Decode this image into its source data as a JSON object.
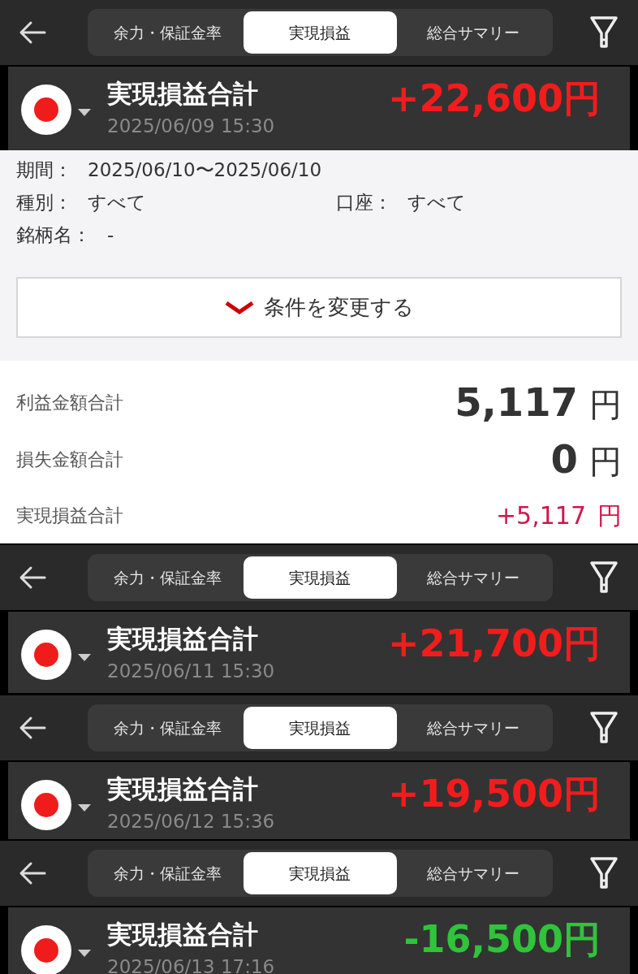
{
  "panels": [
    {
      "tabs": [
        {
          "label": "余力・保証金率",
          "selected": false
        },
        {
          "label": "実現損益",
          "selected": true
        },
        {
          "label": "総合サマリー",
          "selected": false
        }
      ],
      "summary": {
        "title": "実現損益合計",
        "amount": "+22,600円",
        "kind": "gain",
        "timestamp": "2025/06/09 15:30"
      },
      "conditions": {
        "period_label": "期間：",
        "period": "2025/06/10〜2025/06/10",
        "type_label": "種別：",
        "type": "すべて",
        "account_label": "口座：",
        "account": "すべて",
        "symbol_label": "銘柄名：",
        "symbol": "-",
        "change_button": "条件を変更する"
      },
      "totals": [
        {
          "label": "利益金額合計",
          "value": "5,117",
          "unit": "円",
          "kind": "large"
        },
        {
          "label": "損失金額合計",
          "value": "0",
          "unit": "円",
          "kind": "large"
        },
        {
          "label": "実現損益合計",
          "value": "+5,117",
          "unit": "円",
          "kind": "net"
        }
      ]
    },
    {
      "tabs": [
        {
          "label": "余力・保証金率",
          "selected": false
        },
        {
          "label": "実現損益",
          "selected": true
        },
        {
          "label": "総合サマリー",
          "selected": false
        }
      ],
      "summary": {
        "title": "実現損益合計",
        "amount": "+21,700円",
        "kind": "gain",
        "timestamp": "2025/06/11 15:30"
      }
    },
    {
      "tabs": [
        {
          "label": "余力・保証金率",
          "selected": false
        },
        {
          "label": "実現損益",
          "selected": true
        },
        {
          "label": "総合サマリー",
          "selected": false
        }
      ],
      "summary": {
        "title": "実現損益合計",
        "amount": "+19,500円",
        "kind": "gain",
        "timestamp": "2025/06/12 15:36"
      }
    },
    {
      "tabs": [
        {
          "label": "余力・保証金率",
          "selected": false
        },
        {
          "label": "実現損益",
          "selected": true
        },
        {
          "label": "総合サマリー",
          "selected": false
        }
      ],
      "summary": {
        "title": "実現損益合計",
        "amount": "-16,500円",
        "kind": "loss",
        "timestamp": "2025/06/13 17:16"
      }
    }
  ]
}
